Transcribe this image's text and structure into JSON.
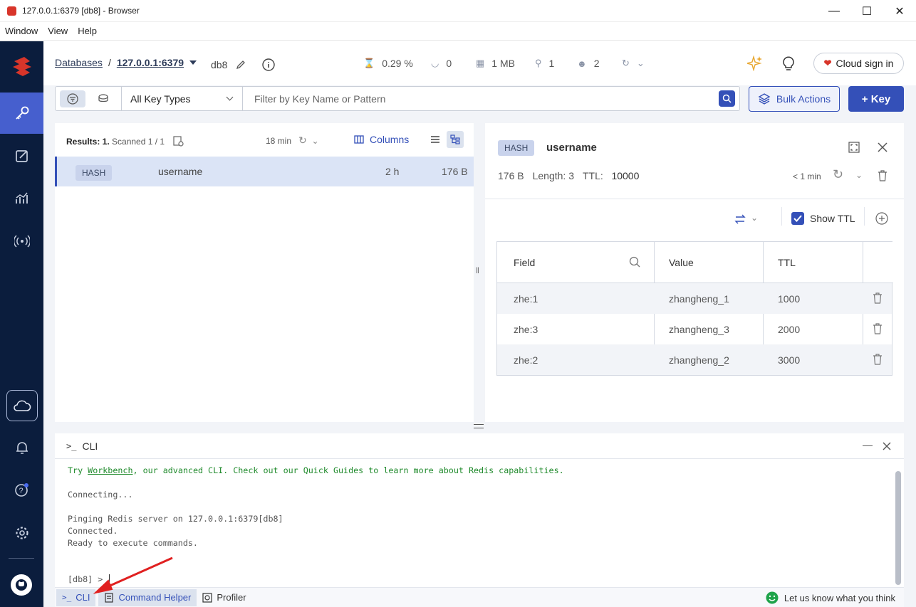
{
  "window": {
    "title": "127.0.0.1:6379 [db8] - Browser"
  },
  "menu": [
    "Window",
    "View",
    "Help"
  ],
  "header": {
    "databases_link": "Databases",
    "separator": "/",
    "connection": "127.0.0.1:6379",
    "db": "db8",
    "stats": {
      "cpu": "0.29 %",
      "ops": "0",
      "memory": "1 MB",
      "keys": "1",
      "clients": "2"
    },
    "cloud_signin": "Cloud sign in"
  },
  "toolbar": {
    "key_type": "All Key Types",
    "filter_placeholder": "Filter by Key Name or Pattern",
    "bulk_actions": "Bulk Actions",
    "add_key": "+ Key"
  },
  "list": {
    "results_label": "Results: 1.",
    "scanned": "Scanned 1 / 1",
    "refreshed": "18 min",
    "columns": "Columns",
    "rows": [
      {
        "type": "HASH",
        "name": "username",
        "ttl": "2 h",
        "size": "176 B"
      }
    ]
  },
  "detail": {
    "type": "HASH",
    "key_name": "username",
    "size": "176 B",
    "length_label": "Length: 3",
    "ttl_label": "TTL:",
    "ttl_value": "10000",
    "updated": "< 1 min",
    "show_ttl": "Show TTL",
    "columns": [
      "Field",
      "Value",
      "TTL"
    ],
    "rows": [
      {
        "field": "zhe:1",
        "value": "zhangheng_1",
        "ttl": "1000"
      },
      {
        "field": "zhe:3",
        "value": "zhangheng_3",
        "ttl": "2000"
      },
      {
        "field": "zhe:2",
        "value": "zhangheng_2",
        "ttl": "3000"
      }
    ]
  },
  "cli": {
    "title": "CLI",
    "prompt_icon": ">_",
    "intro_try": "Try ",
    "intro_link": "Workbench",
    "intro_rest": ", our advanced CLI. Check out our Quick Guides to learn more about Redis capabilities.",
    "line_connecting": "Connecting...",
    "line_ping": "Pinging Redis server on 127.0.0.1:6379[db8]",
    "line_connected": "Connected.",
    "line_ready": "Ready to execute commands.",
    "prompt": "[db8] >"
  },
  "footer": {
    "cli": "CLI",
    "command_helper": "Command Helper",
    "profiler": "Profiler",
    "feedback": "Let us know what you think"
  },
  "colors": {
    "accent": "#3450b8",
    "sidebar": "#0b1d3d",
    "brand": "#d8352a",
    "annotation_arrow": "#e02020"
  }
}
